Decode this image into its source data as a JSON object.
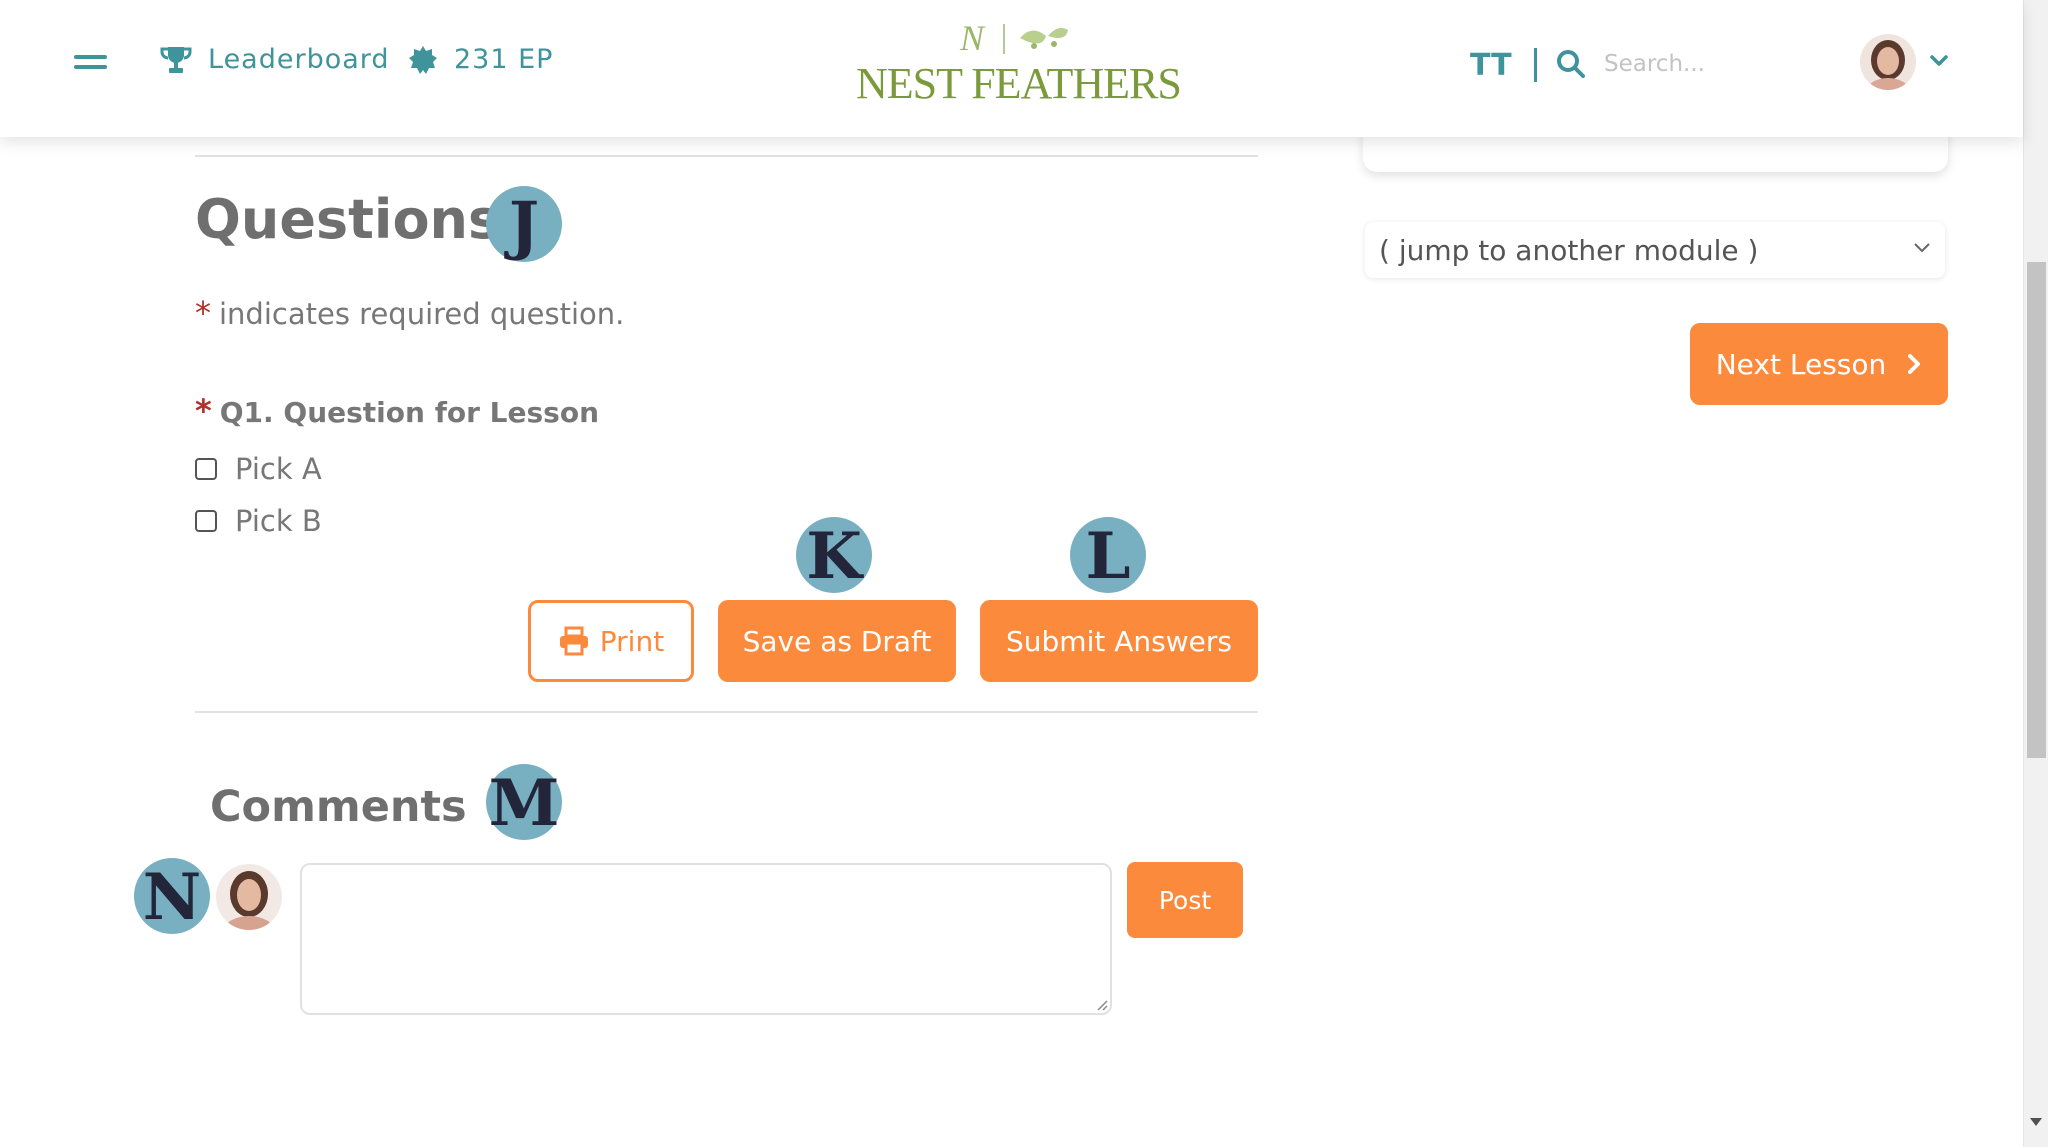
{
  "header": {
    "leaderboard_label": "Leaderboard",
    "points_label": "231 EP",
    "logo_monogram": "N",
    "logo_text": "NEST FEATHERS",
    "text_size_glyph": "TT",
    "search_placeholder": "Search..."
  },
  "questions": {
    "title": "Questions",
    "badge": "J",
    "required_star": "*",
    "required_note": "indicates required question.",
    "q1_label": "Q1. Question for Lesson",
    "options": [
      "Pick A",
      "Pick B"
    ]
  },
  "actions": {
    "print_label": "Print",
    "save_draft_label": "Save as Draft",
    "submit_label": "Submit Answers",
    "badge_k": "K",
    "badge_l": "L"
  },
  "comments": {
    "title": "Comments",
    "badge_m": "M",
    "badge_n": "N",
    "post_label": "Post",
    "comment_value": ""
  },
  "sidebar": {
    "module_select_value": "( jump to another module )",
    "next_lesson_label": "Next Lesson"
  },
  "colors": {
    "teal": "#3f939b",
    "orange": "#fb8a3c",
    "logo_green": "#7a9a3c",
    "badge_blue": "#78b0c2"
  }
}
